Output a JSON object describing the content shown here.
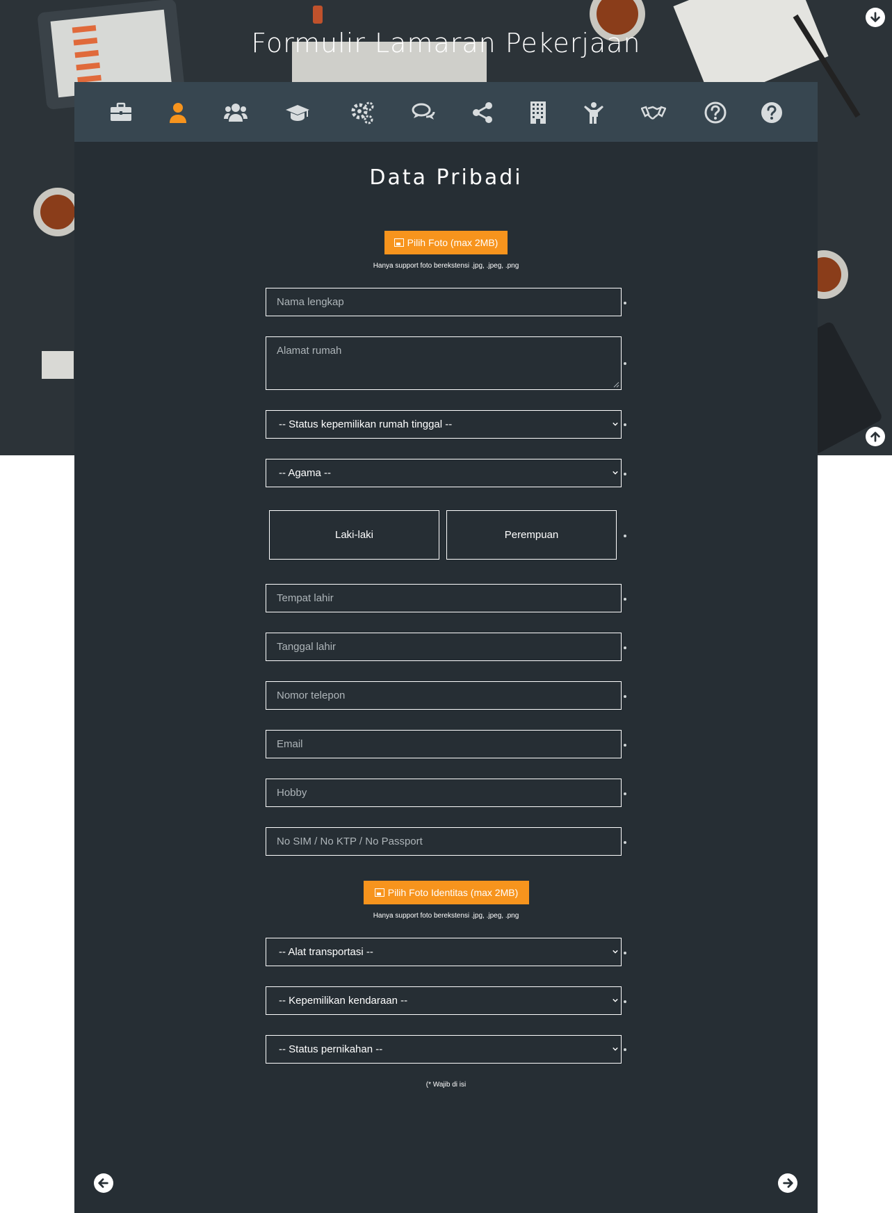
{
  "header": {
    "title": "Formulir Lamaran Pekerjaan"
  },
  "nav_icons": [
    {
      "name": "briefcase-icon",
      "active": false
    },
    {
      "name": "user-icon",
      "active": true
    },
    {
      "name": "users-icon",
      "active": false
    },
    {
      "name": "graduation-cap-icon",
      "active": false
    },
    {
      "name": "gears-icon",
      "active": false
    },
    {
      "name": "comments-icon",
      "active": false
    },
    {
      "name": "share-icon",
      "active": false
    },
    {
      "name": "building-icon",
      "active": false
    },
    {
      "name": "child-icon",
      "active": false
    },
    {
      "name": "handshake-icon",
      "active": false
    },
    {
      "name": "question-circle-outline-icon",
      "active": false
    },
    {
      "name": "question-circle-icon",
      "active": false
    }
  ],
  "colors": {
    "accent": "#f7941d",
    "panel": "#262e34",
    "iconbar": "#374650",
    "icon": "#d8dcde"
  },
  "form": {
    "section_title": "Data Pribadi",
    "photo_button": "Pilih Foto (max 2MB)",
    "photo_hint": "Hanya support foto berekstensi .jpg, .jpeg, .png",
    "full_name_placeholder": "Nama lengkap",
    "address_placeholder": "Alamat rumah",
    "home_status_select": "-- Status kepemilikan rumah tinggal --",
    "religion_select": "-- Agama --",
    "gender_male": "Laki-laki",
    "gender_female": "Perempuan",
    "birthplace_placeholder": "Tempat lahir",
    "birthdate_placeholder": "Tanggal lahir",
    "phone_placeholder": "Nomor telepon",
    "email_placeholder": "Email",
    "hobby_placeholder": "Hobby",
    "id_number_placeholder": "No SIM / No KTP / No Passport",
    "id_photo_button": "Pilih Foto Identitas (max 2MB)",
    "id_photo_hint": "Hanya support foto berekstensi .jpg, .jpeg, .png",
    "transport_select": "-- Alat transportasi --",
    "vehicle_select": "-- Kepemilikan kendaraan --",
    "marital_select": "-- Status pernikahan --",
    "required_note": "(* Wajib di isi"
  }
}
